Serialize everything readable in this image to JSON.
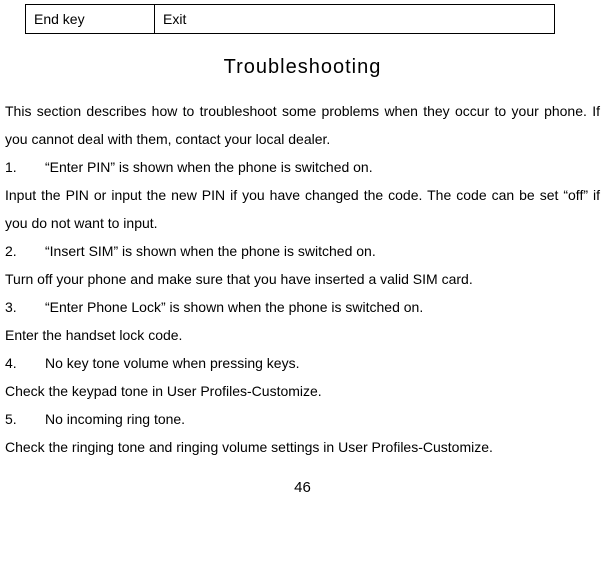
{
  "table": {
    "col1": "End key",
    "col2": "Exit"
  },
  "title": "Troubleshooting",
  "intro": "This section describes how to troubleshoot some problems when they occur to your phone. If you cannot deal with them, contact your local dealer.",
  "items": [
    {
      "num": "1.",
      "q": "“Enter PIN” is shown when the phone is switched on.",
      "a": "Input the PIN or input the new PIN if you have changed the code. The code can be set “off” if you do not want to input."
    },
    {
      "num": "2.",
      "q": "“Insert SIM” is shown when the phone is switched on.",
      "a": "Turn off your phone and make sure that you have inserted a valid SIM card."
    },
    {
      "num": "3.",
      "q": "“Enter Phone Lock” is shown when the phone is switched on.",
      "a": "Enter the handset lock code."
    },
    {
      "num": "4.",
      "q": "No key tone volume when pressing keys.",
      "a": "Check the keypad tone in User Profiles-Customize."
    },
    {
      "num": "5.",
      "q": "No incoming ring tone.",
      "a": "Check the ringing tone and ringing volume settings in User Profiles-Customize."
    }
  ],
  "pageNumber": "46"
}
